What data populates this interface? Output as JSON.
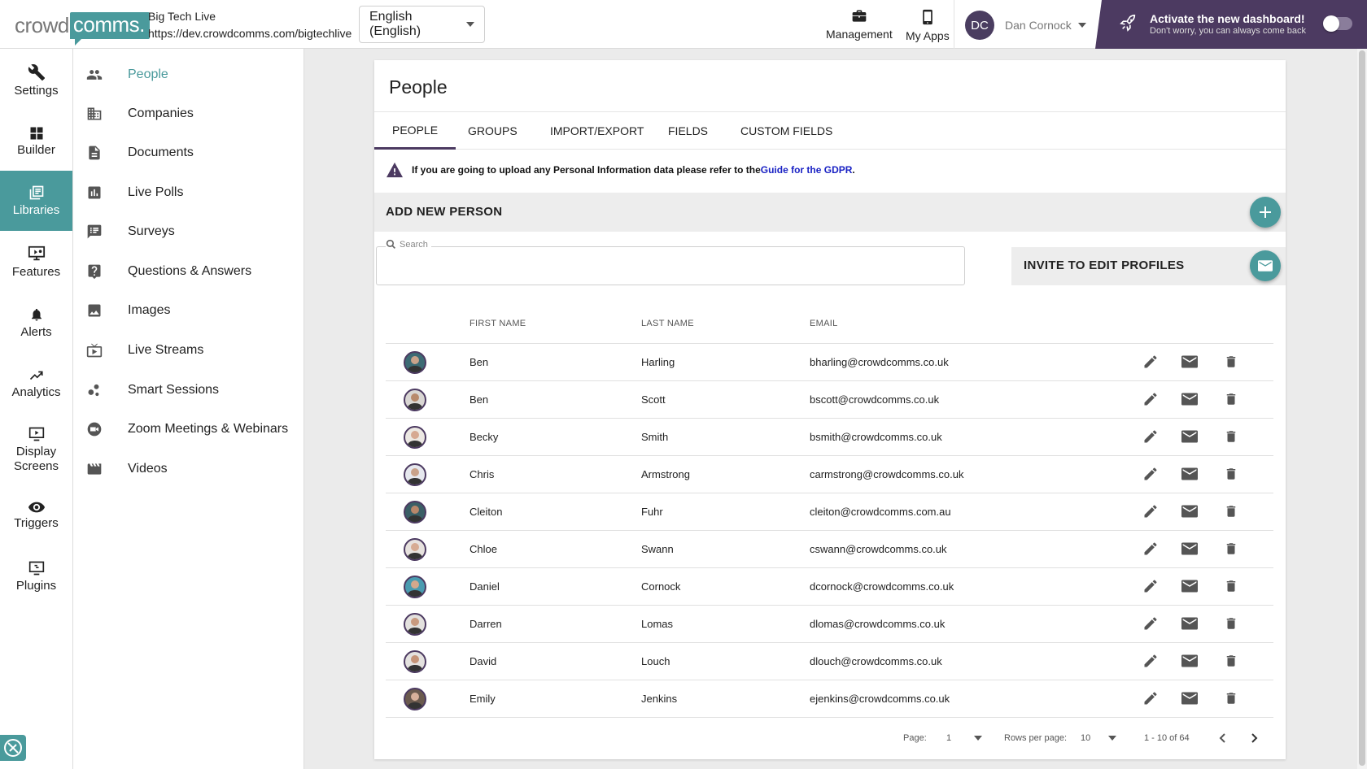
{
  "brand": {
    "logo_part1": "crowd",
    "logo_part2": "comms.",
    "accent_color": "#4a9a9c",
    "dark_color": "#4c3a61"
  },
  "event": {
    "name": "Big Tech Live",
    "url": "https://dev.crowdcomms.com/bigtechlive"
  },
  "language": {
    "selected": "English (English)"
  },
  "topnav": {
    "management": "Management",
    "my_apps": "My Apps"
  },
  "user": {
    "initials": "DC",
    "name": "Dan Cornock"
  },
  "activate": {
    "title": "Activate the new dashboard!",
    "subtitle": "Don't worry, you can always come back"
  },
  "leftnav": {
    "items": [
      {
        "label": "Settings",
        "icon": "wrench-icon"
      },
      {
        "label": "Builder",
        "icon": "grid-icon"
      },
      {
        "label": "Libraries",
        "icon": "library-icon"
      },
      {
        "label": "Features",
        "icon": "features-icon"
      },
      {
        "label": "Alerts",
        "icon": "bell-icon"
      },
      {
        "label": "Analytics",
        "icon": "trend-icon"
      },
      {
        "label": "Display Screens",
        "icon": "display-icon"
      },
      {
        "label": "Triggers",
        "icon": "eye-icon"
      },
      {
        "label": "Plugins",
        "icon": "plugin-icon"
      }
    ]
  },
  "subnav": {
    "items": [
      {
        "label": "People",
        "icon": "people-icon"
      },
      {
        "label": "Companies",
        "icon": "building-icon"
      },
      {
        "label": "Documents",
        "icon": "document-icon"
      },
      {
        "label": "Live Polls",
        "icon": "poll-icon"
      },
      {
        "label": "Surveys",
        "icon": "survey-icon"
      },
      {
        "label": "Questions & Answers",
        "icon": "question-icon"
      },
      {
        "label": "Images",
        "icon": "image-icon"
      },
      {
        "label": "Live Streams",
        "icon": "live-tv-icon"
      },
      {
        "label": "Smart Sessions",
        "icon": "bubbles-icon"
      },
      {
        "label": "Zoom Meetings & Webinars",
        "icon": "video-camera-icon"
      },
      {
        "label": "Videos",
        "icon": "clapper-icon"
      }
    ]
  },
  "page": {
    "title": "People"
  },
  "tabs": [
    "PEOPLE",
    "GROUPS",
    "IMPORT/EXPORT",
    "FIELDS",
    "CUSTOM FIELDS"
  ],
  "gdpr": {
    "text": "If you are going to upload any Personal Information data please refer to the ",
    "link": "Guide for the GDPR",
    "end": "."
  },
  "add_person": {
    "label": "ADD NEW PERSON"
  },
  "search": {
    "label": "Search"
  },
  "invite": {
    "label": "INVITE TO EDIT PROFILES"
  },
  "table": {
    "headers": {
      "first": "FIRST NAME",
      "last": "LAST NAME",
      "email": "EMAIL"
    },
    "rows": [
      {
        "first": "Ben",
        "last": "Harling",
        "email": "bharling@crowdcomms.co.uk",
        "bg": "#3d6b74",
        "skin": "#caa38a"
      },
      {
        "first": "Ben",
        "last": "Scott",
        "email": "bscott@crowdcomms.co.uk",
        "bg": "#d9d6d3",
        "skin": "#b88a6c"
      },
      {
        "first": "Becky",
        "last": "Smith",
        "email": "bsmith@crowdcomms.co.uk",
        "bg": "#ece8e3",
        "skin": "#d6a992"
      },
      {
        "first": "Chris",
        "last": "Armstrong",
        "email": "carmstrong@crowdcomms.co.uk",
        "bg": "#e6e8ee",
        "skin": "#c9a28a"
      },
      {
        "first": "Cleiton",
        "last": "Fuhr",
        "email": "cleiton@crowdcomms.com.au",
        "bg": "#3b5f66",
        "skin": "#b9876a"
      },
      {
        "first": "Chloe",
        "last": "Swann",
        "email": "cswann@crowdcomms.co.uk",
        "bg": "#e7e2de",
        "skin": "#d7ac93"
      },
      {
        "first": "Daniel",
        "last": "Cornock",
        "email": "dcornock@crowdcomms.co.uk",
        "bg": "#4a9bb0",
        "skin": "#d4a88c"
      },
      {
        "first": "Darren",
        "last": "Lomas",
        "email": "dlomas@crowdcomms.co.uk",
        "bg": "#e3e1de",
        "skin": "#c99b80"
      },
      {
        "first": "David",
        "last": "Louch",
        "email": "dlouch@crowdcomms.co.uk",
        "bg": "#e4e2df",
        "skin": "#c59478"
      },
      {
        "first": "Emily",
        "last": "Jenkins",
        "email": "ejenkins@crowdcomms.co.uk",
        "bg": "#6b5a4e",
        "skin": "#d8b09a"
      }
    ]
  },
  "pagination": {
    "page_label": "Page:",
    "page": "1",
    "rows_label": "Rows per page:",
    "rows": "10",
    "range": "1 - 10 of 64"
  }
}
